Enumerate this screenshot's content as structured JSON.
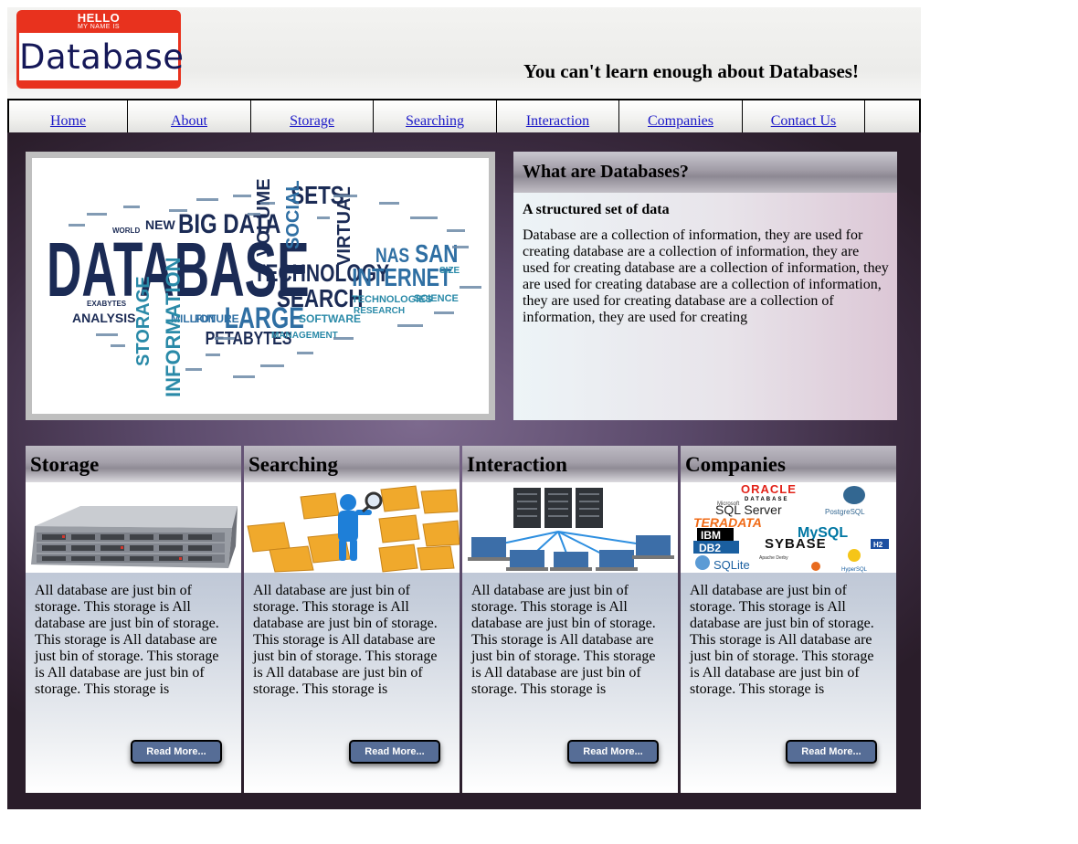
{
  "header": {
    "logo": {
      "top_text": "HELLO",
      "small_text": "MY NAME IS",
      "name": "Database"
    },
    "tagline": "You can't learn enough about Databases!"
  },
  "nav": {
    "items": [
      {
        "label": "Home"
      },
      {
        "label": "About"
      },
      {
        "label": "Storage"
      },
      {
        "label": "Searching"
      },
      {
        "label": "Interaction"
      },
      {
        "label": "Companies"
      },
      {
        "label": "Contact Us"
      }
    ]
  },
  "hero": {
    "word_cloud": [
      "DATABASE",
      "BIG DATA",
      "SETS",
      "TECHNOLOGY",
      "INTERNET",
      "SEARCH",
      "LARGE",
      "VOLUME",
      "SOCIAL",
      "VIRTUAL",
      "NAS",
      "SAN",
      "STORAGE",
      "INFORMATION",
      "ANALYSIS",
      "PETABYTES",
      "MILLION",
      "FUTURE",
      "SOFTWARE",
      "MANAGEMENT",
      "TECHNOLOGIES",
      "SCIENCE",
      "RESEARCH",
      "NEW",
      "SIZE",
      "WORLD",
      "EXABYTES"
    ]
  },
  "info": {
    "title": "What are Databases?",
    "subtitle": "A structured set of data",
    "body": "Database are a collection of information, they are used for creating database are a collection of information, they are used for creating database are a collection of information, they are used for creating database are a collection of information, they are used for creating database are a collection of information, they are used for creating"
  },
  "cards": [
    {
      "title": "Storage",
      "text": "All database are just bin of storage. This storage is All database are just bin of storage. This storage is All database are just bin of storage. This storage is All database are just bin of storage. This storage is",
      "button": "Read More..."
    },
    {
      "title": "Searching",
      "text": "All database are just bin of storage. This storage is All database are just bin of storage. This storage is All database are just bin of storage. This storage is All database are just bin of storage. This storage is",
      "button": "Read More..."
    },
    {
      "title": "Interaction",
      "text": "All database are just bin of storage. This storage is All database are just bin of storage. This storage is All database are just bin of storage. This storage is All database are just bin of storage. This storage is",
      "button": "Read More..."
    },
    {
      "title": "Companies",
      "text": "All database are just bin of storage. This storage is All database are just bin of storage. This storage is All database are just bin of storage. This storage is All database are just bin of storage. This storage is",
      "button": "Read More...",
      "logos": [
        "ORACLE",
        "DATABASE",
        "Microsoft",
        "SQL Server",
        "PostgreSQL",
        "TERADATA",
        "IBM",
        "DB2",
        "MySQL",
        "SYBASE",
        "H2",
        "Apache Derby",
        "SQLite",
        "HyperSQL"
      ]
    }
  ],
  "colors": {
    "link": "#1d1ac8",
    "logo_red": "#e8321e",
    "logo_navy": "#151858",
    "button": "#566d96",
    "main_bg": "#5b4a6b"
  }
}
